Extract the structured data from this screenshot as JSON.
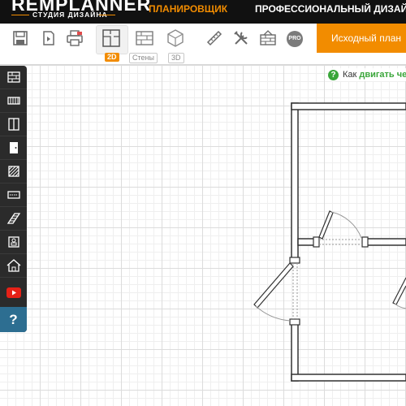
{
  "header": {
    "logo_main": "REMPLANNER",
    "logo_sub": "СТУДИЯ ДИЗАЙНА",
    "nav": [
      "ПЛАНИРОВЩИК",
      "ПРОФЕССИОНАЛЬНЫЙ ДИЗАЙН"
    ]
  },
  "toolbar": {
    "icons": [
      "save-icon",
      "import-icon",
      "print-icon",
      "plan-2d-icon",
      "walls-icon",
      "view-3d-icon",
      "ruler-icon",
      "tools-icon",
      "wall-render-icon"
    ],
    "view_labels": {
      "v2d": "2D",
      "walls": "Стены",
      "v3d": "3D"
    },
    "active_view": "2D",
    "pro_label": "PRO",
    "source_plan_label": "Исходный план"
  },
  "hint": {
    "text": "Как",
    "link": "двигать че"
  },
  "sidebar": {
    "items": [
      "brick-wall-icon",
      "railing-icon",
      "door-panel-icon",
      "door-icon",
      "floor-texture-icon",
      "radiator-icon",
      "stairs-icon",
      "furniture-icon",
      "house-icon",
      "youtube-icon"
    ],
    "help_label": "?"
  },
  "colors": {
    "accent": "#f28c00",
    "topbar": "#111111",
    "sidebar": "#2b2b2b",
    "help": "#2d6e91",
    "hint_green": "#3aa63a"
  }
}
